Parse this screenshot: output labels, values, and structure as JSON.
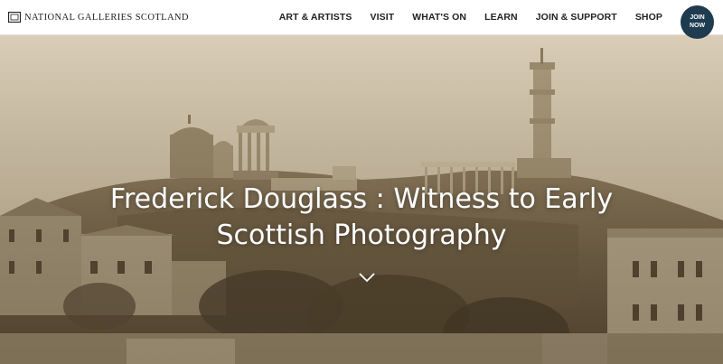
{
  "header": {
    "logo_text": "NATIONAL GALLERIES SCOTLAND",
    "logo_icon": "gallery-frame-icon",
    "nav": [
      {
        "label": "ART & ARTISTS"
      },
      {
        "label": "VISIT"
      },
      {
        "label": "WHAT'S ON"
      },
      {
        "label": "LEARN"
      },
      {
        "label": "JOIN & SUPPORT"
      },
      {
        "label": "SHOP"
      }
    ],
    "join_button": "JOIN NOW"
  },
  "hero": {
    "title": "Frederick Douglass : Witness to Early Scottish Photography",
    "scroll_icon": "chevron-down-icon"
  },
  "colors": {
    "join_button_bg": "#1f3b4f",
    "header_bg": "#ffffff",
    "hero_sepia": "#c9b99c",
    "title_text": "#ffffff"
  }
}
